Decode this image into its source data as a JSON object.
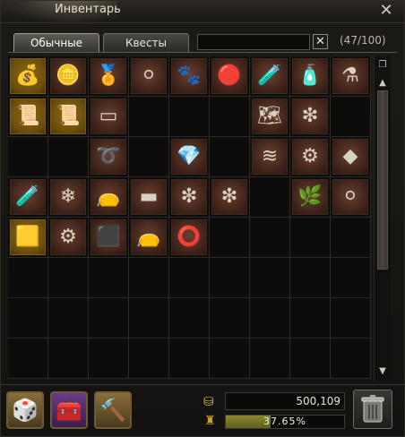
{
  "window": {
    "title": "Инвентарь"
  },
  "tabs": [
    {
      "label": "Обычные",
      "active": true
    },
    {
      "label": "Квесты",
      "active": false
    }
  ],
  "search": {
    "value": "",
    "placeholder": ""
  },
  "count_label": "(47/100)",
  "grid_columns": 9,
  "items": [
    {
      "slot": 0,
      "icon": "gold-coins-icon",
      "sym": "💰",
      "gold": true
    },
    {
      "slot": 1,
      "icon": "seal-coin-icon",
      "sym": "🪙"
    },
    {
      "slot": 2,
      "icon": "gold-medal-icon",
      "sym": "🏅"
    },
    {
      "slot": 3,
      "icon": "silver-rune-icon",
      "sym": "⚪"
    },
    {
      "slot": 4,
      "icon": "fluffy-fur-icon",
      "sym": "🐾"
    },
    {
      "slot": 5,
      "icon": "red-amulet-icon",
      "sym": "🔴"
    },
    {
      "slot": 6,
      "icon": "green-potion-icon",
      "sym": "🧪"
    },
    {
      "slot": 7,
      "icon": "white-vial-icon",
      "sym": "🧴"
    },
    {
      "slot": 8,
      "icon": "orange-flask-icon",
      "sym": "⚗"
    },
    {
      "slot": 9,
      "icon": "gold-scroll-icon",
      "sym": "📜",
      "gold": true
    },
    {
      "slot": 10,
      "icon": "gold-scroll-icon",
      "sym": "📜",
      "gold": true
    },
    {
      "slot": 11,
      "icon": "silver-ingots-icon",
      "sym": "▭"
    },
    {
      "slot": 15,
      "icon": "old-map-icon",
      "sym": "🗺"
    },
    {
      "slot": 16,
      "icon": "green-gem-rod-icon",
      "sym": "❇"
    },
    {
      "slot": 20,
      "icon": "rope-coil-icon",
      "sym": "➰"
    },
    {
      "slot": 22,
      "icon": "crystal-cluster-icon",
      "sym": "💎"
    },
    {
      "slot": 24,
      "icon": "yellow-thread-icon",
      "sym": "≋"
    },
    {
      "slot": 25,
      "icon": "thread-spool-icon",
      "sym": "⚙"
    },
    {
      "slot": 26,
      "icon": "silver-ore-icon",
      "sym": "◆"
    },
    {
      "slot": 27,
      "icon": "blue-potion-icon",
      "sym": "🧪"
    },
    {
      "slot": 28,
      "icon": "blue-crystal-icon",
      "sym": "❄"
    },
    {
      "slot": 29,
      "icon": "leather-pouch-icon",
      "sym": "👝"
    },
    {
      "slot": 30,
      "icon": "steel-ingots-icon",
      "sym": "▬"
    },
    {
      "slot": 31,
      "icon": "green-gem-rod-icon",
      "sym": "❇"
    },
    {
      "slot": 32,
      "icon": "green-gem-rod-icon",
      "sym": "❇"
    },
    {
      "slot": 34,
      "icon": "branches-icon",
      "sym": "🌿"
    },
    {
      "slot": 35,
      "icon": "pearl-orb-icon",
      "sym": "⚪"
    },
    {
      "slot": 36,
      "icon": "yellow-cloth-icon",
      "sym": "🟨",
      "gold": true
    },
    {
      "slot": 37,
      "icon": "spool-icon",
      "sym": "⚙"
    },
    {
      "slot": 38,
      "icon": "coal-ore-icon",
      "sym": "⬛"
    },
    {
      "slot": 39,
      "icon": "leather-pouch-icon",
      "sym": "👝"
    },
    {
      "slot": 40,
      "icon": "leather-belt-icon",
      "sym": "⭕"
    }
  ],
  "total_slots": 72,
  "bottom": {
    "actions": [
      {
        "name": "dice-button",
        "sym": "🎲"
      },
      {
        "name": "chest-button",
        "sym": "🧰"
      },
      {
        "name": "craft-button",
        "sym": "🔨"
      }
    ],
    "adena": "500,109",
    "weight_label": "37.65%",
    "weight_percent": 37.65
  }
}
